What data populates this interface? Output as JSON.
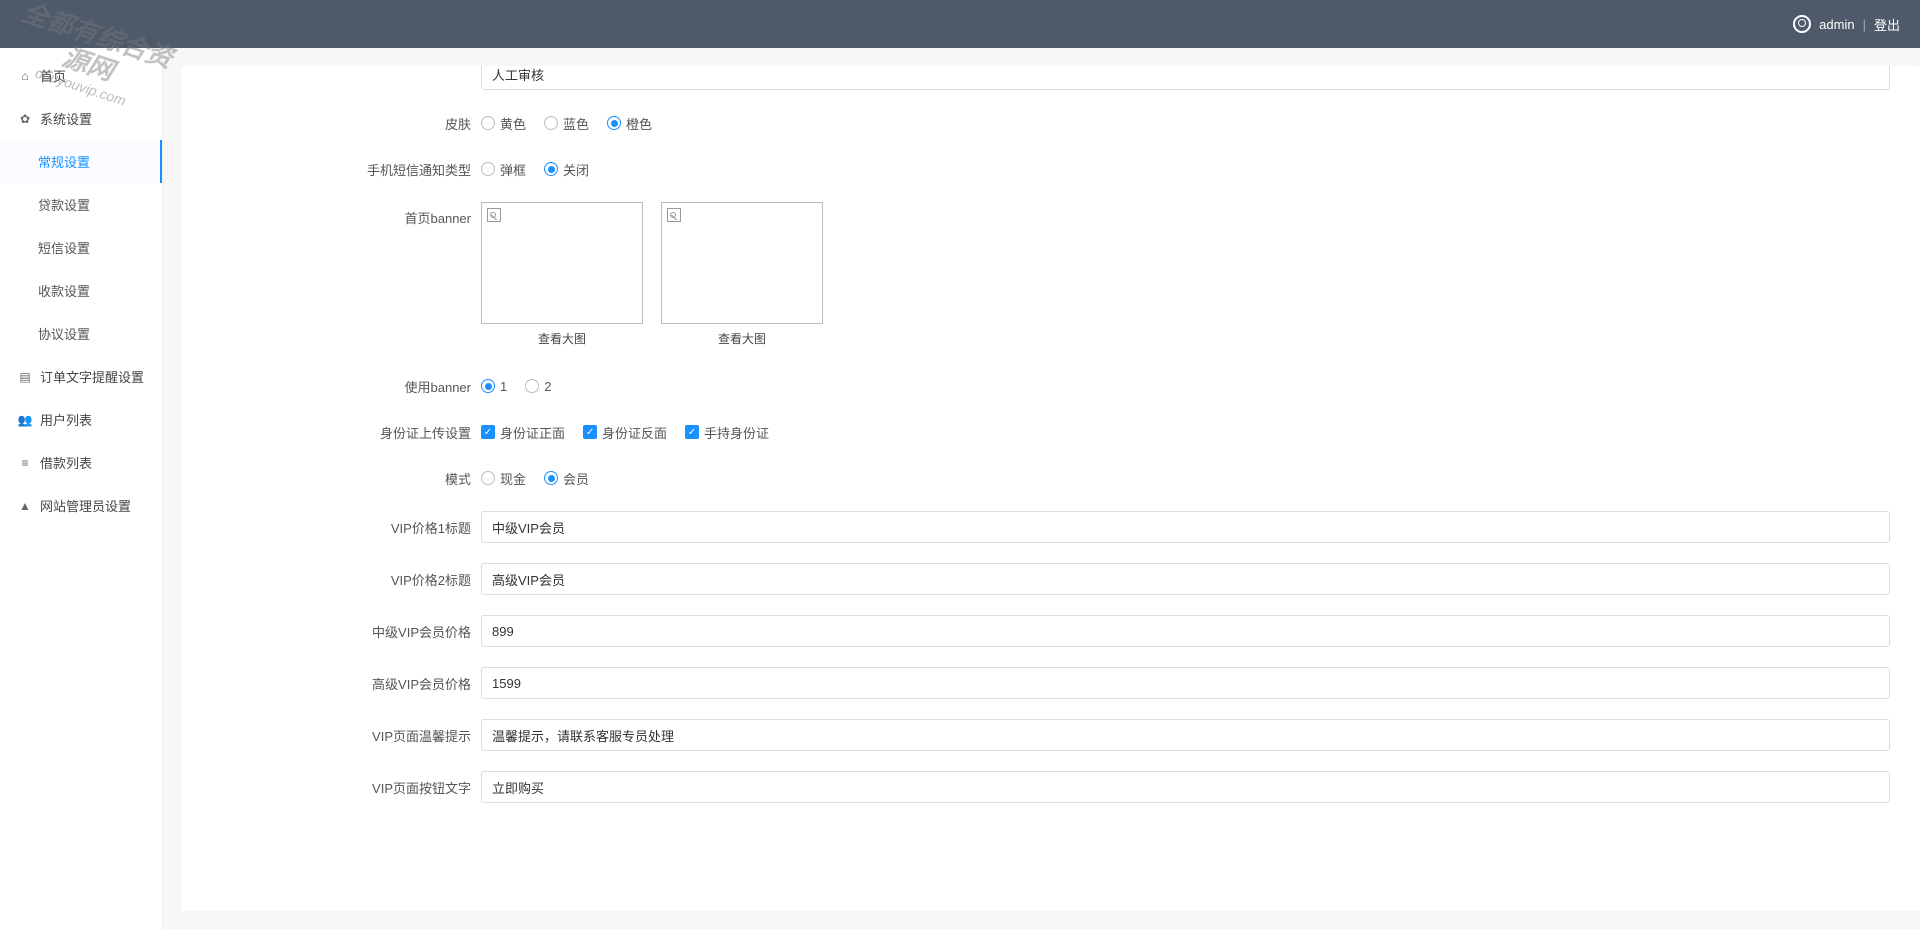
{
  "header": {
    "username": "admin",
    "logout": "登出"
  },
  "sidebar": {
    "items": [
      {
        "icon": "home",
        "label": "首页",
        "sub": false
      },
      {
        "icon": "gear",
        "label": "系统设置",
        "sub": false
      },
      {
        "icon": "",
        "label": "常规设置",
        "sub": true,
        "active": true
      },
      {
        "icon": "",
        "label": "贷款设置",
        "sub": true
      },
      {
        "icon": "",
        "label": "短信设置",
        "sub": true
      },
      {
        "icon": "",
        "label": "收款设置",
        "sub": true
      },
      {
        "icon": "",
        "label": "协议设置",
        "sub": true
      },
      {
        "icon": "doc",
        "label": "订单文字提醒设置",
        "sub": false
      },
      {
        "icon": "users",
        "label": "用户列表",
        "sub": false
      },
      {
        "icon": "list",
        "label": "借款列表",
        "sub": false
      },
      {
        "icon": "person",
        "label": "网站管理员设置",
        "sub": false
      }
    ]
  },
  "form": {
    "cut_top_label": "",
    "cut_top_value": "人工审核",
    "skin": {
      "label": "皮肤",
      "options": [
        "黄色",
        "蓝色",
        "橙色"
      ],
      "selected": 2
    },
    "sms_type": {
      "label": "手机短信通知类型",
      "options": [
        "弹框",
        "关闭"
      ],
      "selected": 1
    },
    "homepage_banner": {
      "label": "首页banner",
      "caption": "查看大图",
      "count": 2
    },
    "use_banner": {
      "label": "使用banner",
      "options": [
        "1",
        "2"
      ],
      "selected": 0
    },
    "id_upload": {
      "label": "身份证上传设置",
      "options": [
        "身份证正面",
        "身份证反面",
        "手持身份证"
      ],
      "checked": [
        true,
        true,
        true
      ]
    },
    "mode": {
      "label": "模式",
      "options": [
        "现金",
        "会员"
      ],
      "selected": 1
    },
    "vip1_title": {
      "label": "VIP价格1标题",
      "value": "中级VIP会员"
    },
    "vip2_title": {
      "label": "VIP价格2标题",
      "value": "高级VIP会员"
    },
    "mid_vip_price": {
      "label": "中级VIP会员价格",
      "value": "899"
    },
    "high_vip_price": {
      "label": "高级VIP会员价格",
      "value": "1599"
    },
    "vip_warm_tip": {
      "label": "VIP页面温馨提示",
      "value": "温馨提示，请联系客服专员处理"
    },
    "vip_btn_text": {
      "label": "VIP页面按钮文字",
      "value": "立即购买"
    }
  },
  "watermark": {
    "line1": "全都有综合资源网",
    "line2": "douyouvip.com"
  },
  "icon_glyphs": {
    "home": "⌂",
    "gear": "✿",
    "doc": "▤",
    "users": "👥",
    "list": "≡",
    "person": "▲"
  }
}
